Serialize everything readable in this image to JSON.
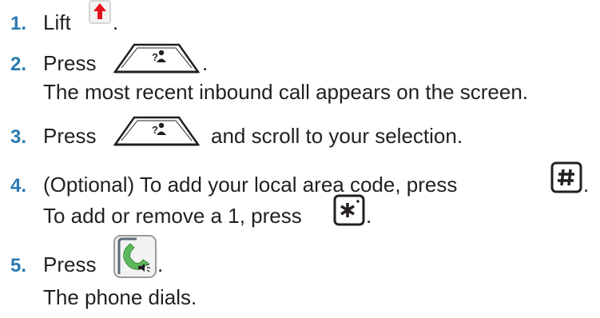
{
  "colors": {
    "step_number": "#2a7ab0",
    "text": "#231f20",
    "lift_arrow": "#e0141c",
    "call_green": "#5cb85c"
  },
  "steps": [
    {
      "number": "1.",
      "lines": [
        {
          "before": "Lift",
          "after": "."
        }
      ],
      "icon": "lift-handset-icon"
    },
    {
      "number": "2.",
      "lines": [
        {
          "before": "Press",
          "after": "."
        },
        {
          "text": "The most recent inbound call appears on the screen."
        }
      ],
      "icon": "call-log-softkey-icon"
    },
    {
      "number": "3.",
      "lines": [
        {
          "before": "Press",
          "after": "and scroll to your selection."
        }
      ],
      "icon": "call-log-softkey-icon"
    },
    {
      "number": "4.",
      "lines": [
        {
          "before": "(Optional) To add your local area code, press",
          "after": "."
        },
        {
          "before": "To add or remove a 1, press",
          "after": "."
        }
      ],
      "icons": [
        "pound-key-icon",
        "star-key-icon"
      ]
    },
    {
      "number": "5.",
      "lines": [
        {
          "before": "Press",
          "after": "."
        },
        {
          "text": "The phone dials."
        }
      ],
      "icon": "speaker-call-key-icon"
    }
  ]
}
